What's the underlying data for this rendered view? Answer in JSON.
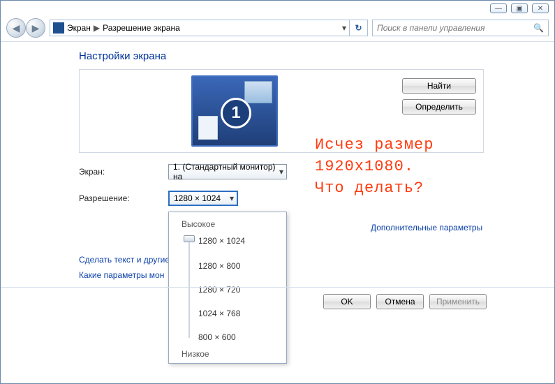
{
  "window_controls": {
    "minimize": "—",
    "maximize": "▣",
    "close": "✕"
  },
  "nav": {
    "back": "◀",
    "forward": "▶",
    "breadcrumb": {
      "item1": "Экран",
      "sep": "▶",
      "item2": "Разрешение экрана"
    },
    "dropdown_arrow": "▾",
    "refresh": "↻",
    "search_placeholder": "Поиск в панели управления",
    "search_icon": "🔍"
  },
  "title": "Настройки экрана",
  "preview": {
    "monitor_number": "1",
    "find_btn": "Найти",
    "identify_btn": "Определить"
  },
  "form": {
    "display_label": "Экран:",
    "display_value": "1. (Стандартный монитор) на",
    "resolution_label": "Разрешение:",
    "resolution_value": "1280 × 1024"
  },
  "res_popup": {
    "high": "Высокое",
    "low": "Низкое",
    "options": [
      "1280 × 1024",
      "1280 × 800",
      "1280 × 720",
      "1024 × 768",
      "800 × 600"
    ]
  },
  "links": {
    "text_size": "Сделать текст и другие",
    "which_params": "Какие параметры мон",
    "advanced": "Дополнительные параметры"
  },
  "annotation": "Исчез размер\n1920х1080.\nЧто делать?",
  "buttons": {
    "ok": "OK",
    "cancel": "Отмена",
    "apply": "Применить"
  },
  "arrow": "▾"
}
